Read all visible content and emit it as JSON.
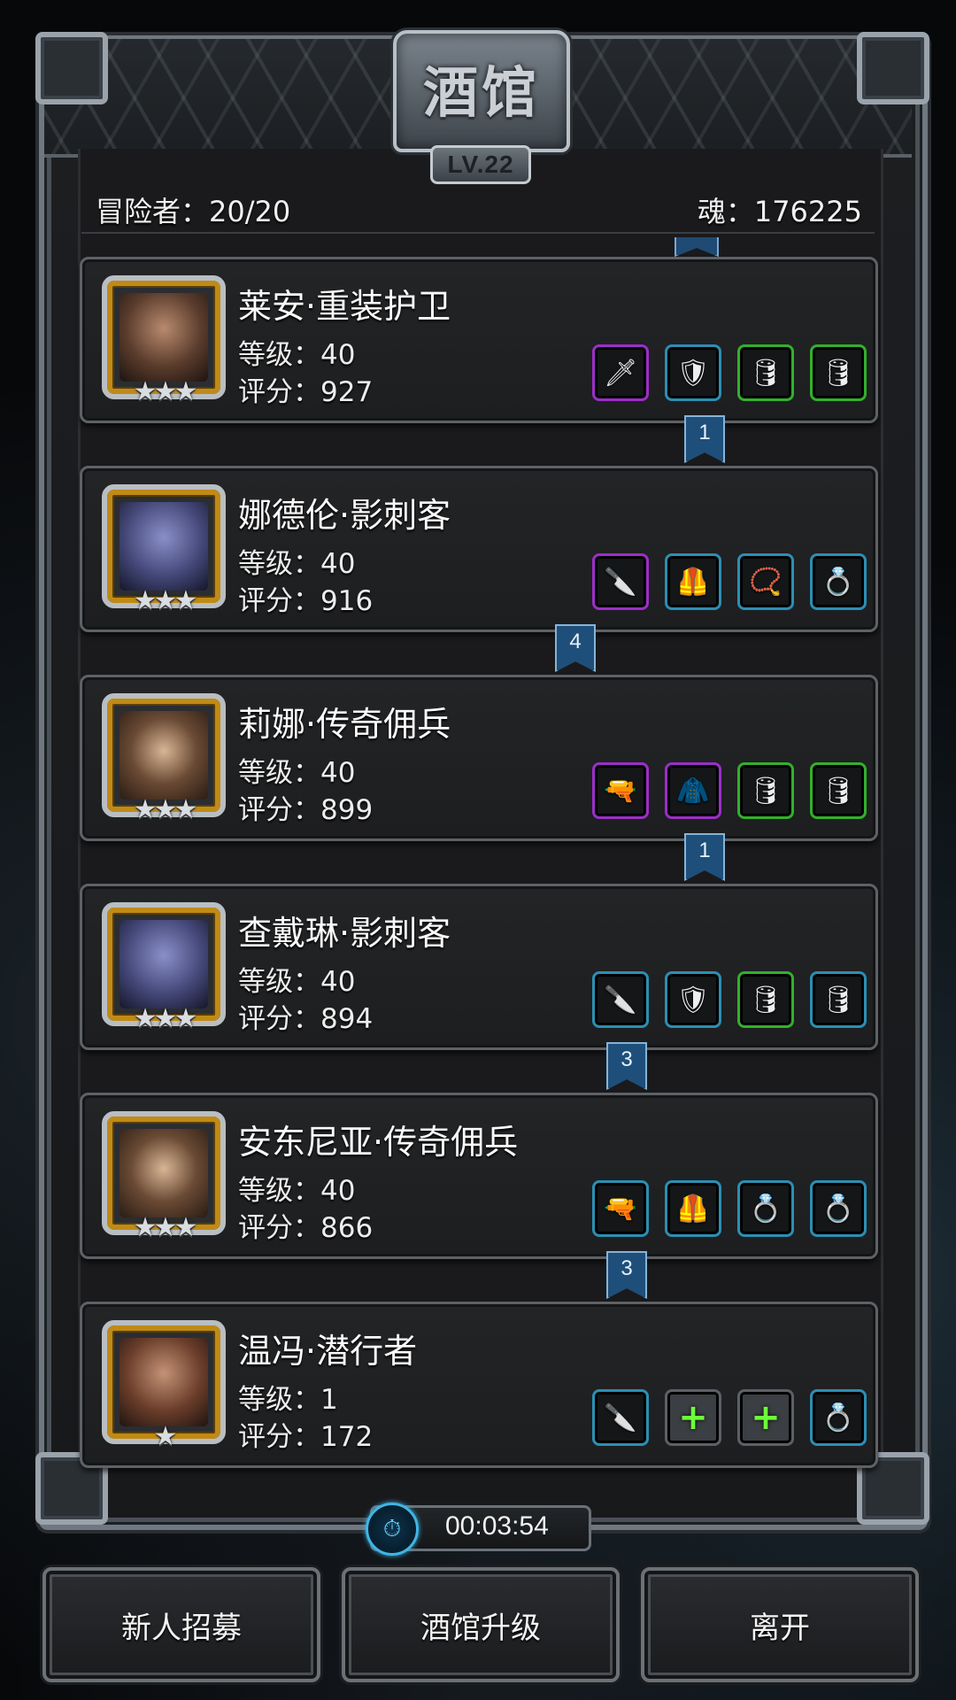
{
  "header": {
    "title": "酒馆",
    "level_badge": "LV.22",
    "adventurers_label": "冒险者：20/20",
    "soul_label": "魂：176225"
  },
  "heroes": [
    {
      "name": "莱安·重装护卫",
      "level": "等级：40",
      "score": "评分：927",
      "stars": "★★★",
      "ribbon": "1",
      "slots": [
        {
          "rarity": "purple",
          "icon": "sword-icon"
        },
        {
          "rarity": "teal",
          "icon": "armor-icon"
        },
        {
          "rarity": "green",
          "icon": "barrel-icon"
        },
        {
          "rarity": "green",
          "icon": "barrel-icon"
        }
      ]
    },
    {
      "name": "娜德伦·影刺客",
      "level": "等级：40",
      "score": "评分：916",
      "stars": "★★★",
      "ribbon": "4",
      "slots": [
        {
          "rarity": "purple",
          "icon": "curved-blade-icon"
        },
        {
          "rarity": "teal",
          "icon": "chest-armor-icon"
        },
        {
          "rarity": "teal",
          "icon": "amulet-icon"
        },
        {
          "rarity": "teal",
          "icon": "ring-icon"
        }
      ]
    },
    {
      "name": "莉娜·传奇佣兵",
      "level": "等级：40",
      "score": "评分：899",
      "stars": "★★★",
      "ribbon": "1",
      "slots": [
        {
          "rarity": "purple",
          "icon": "pistol-icon"
        },
        {
          "rarity": "purple",
          "icon": "coat-icon"
        },
        {
          "rarity": "green",
          "icon": "barrel-icon"
        },
        {
          "rarity": "green",
          "icon": "barrel-icon"
        }
      ]
    },
    {
      "name": "查戴琳·影刺客",
      "level": "等级：40",
      "score": "评分：894",
      "stars": "★★★",
      "ribbon": "3",
      "slots": [
        {
          "rarity": "teal",
          "icon": "curved-blade-icon"
        },
        {
          "rarity": "teal",
          "icon": "armor-icon"
        },
        {
          "rarity": "green",
          "icon": "barrel-icon"
        },
        {
          "rarity": "teal",
          "icon": "barrel-icon"
        }
      ]
    },
    {
      "name": "安东尼亚·传奇佣兵",
      "level": "等级：40",
      "score": "评分：866",
      "stars": "★★★",
      "ribbon": "3",
      "slots": [
        {
          "rarity": "teal",
          "icon": "pistol-icon"
        },
        {
          "rarity": "teal",
          "icon": "chest-armor-icon"
        },
        {
          "rarity": "teal",
          "icon": "ring-icon"
        },
        {
          "rarity": "teal",
          "icon": "ring-icon"
        }
      ]
    },
    {
      "name": "温冯·潜行者",
      "level": "等级：1",
      "score": "评分：172",
      "stars": "★",
      "ribbon": "",
      "slots": [
        {
          "rarity": "teal",
          "icon": "curved-blade-icon"
        },
        {
          "rarity": "grey",
          "icon": "add-armor-icon"
        },
        {
          "rarity": "grey",
          "icon": "add-accessory-icon"
        },
        {
          "rarity": "teal",
          "icon": "ring-icon"
        }
      ]
    }
  ],
  "timer": {
    "text": "00:03:54",
    "icon": "stopwatch-icon"
  },
  "buttons": {
    "recruit": "新人招募",
    "upgrade": "酒馆升级",
    "leave": "离开"
  }
}
